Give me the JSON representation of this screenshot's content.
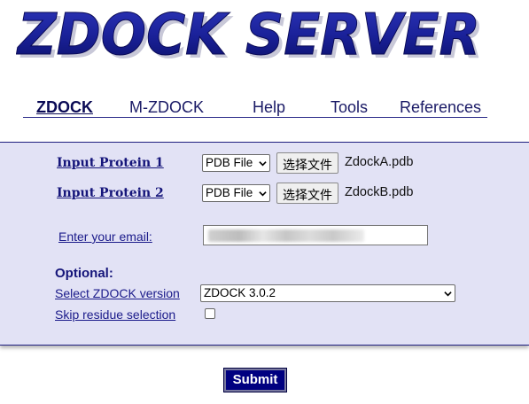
{
  "logo": {
    "text": "ZDOCK SERVER"
  },
  "nav": {
    "items": [
      {
        "label": "ZDOCK",
        "active": true
      },
      {
        "label": "M-ZDOCK"
      },
      {
        "label": "Help"
      },
      {
        "label": "Tools"
      },
      {
        "label": "References"
      }
    ]
  },
  "form": {
    "protein1": {
      "label": "Input Protein 1",
      "format": "PDB File",
      "choose_button": "选择文件",
      "file_name": "ZdockA.pdb"
    },
    "protein2": {
      "label": "Input Protein 2",
      "format": "PDB File",
      "choose_button": "选择文件",
      "file_name": "ZdockB.pdb"
    },
    "email": {
      "label": "Enter your email:"
    },
    "optional": {
      "heading": "Optional:",
      "version_label": "Select ZDOCK version",
      "version_value": "ZDOCK 3.0.2",
      "skip_label": "Skip residue selection",
      "skip_checked": false
    },
    "submit_label": "Submit"
  },
  "colors": {
    "brand_navy": "#000080",
    "panel_bg": "#e2e2f5",
    "link": "#1a1a8a"
  }
}
